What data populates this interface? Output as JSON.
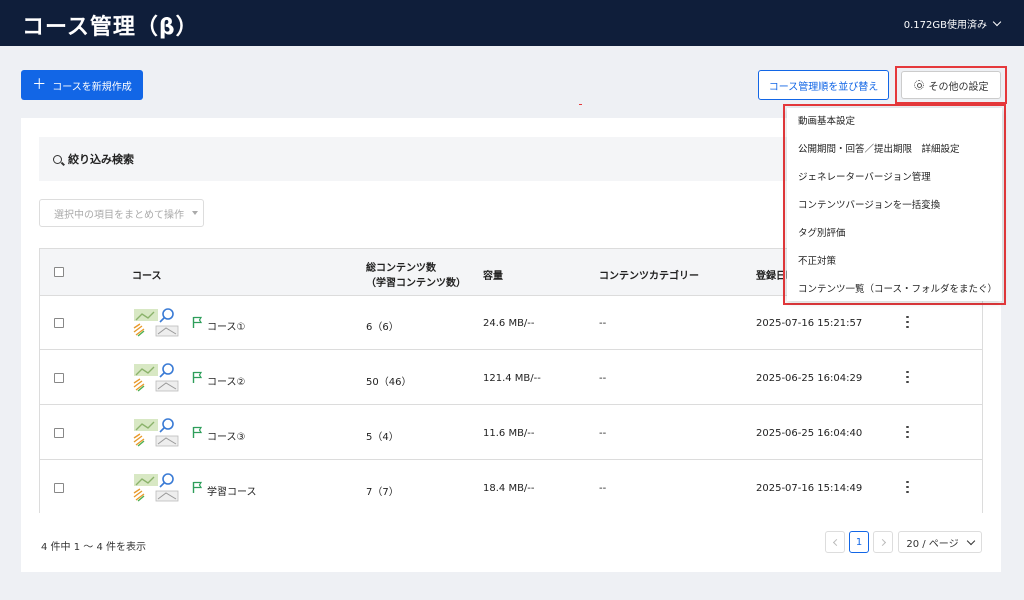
{
  "header": {
    "title": "コース管理（β）",
    "usage": "0.172GB使用済み"
  },
  "toolbar": {
    "new_course": "コースを新規作成",
    "sort": "コース管理順を並び替え",
    "settings": "その他の設定"
  },
  "settings_menu": [
    "動画基本設定",
    "公開期間・回答／提出期限　詳細設定",
    "ジェネレーターバージョン管理",
    "コンテンツバージョンを一括変換",
    "タグ別評価",
    "不正対策",
    "コンテンツ一覧（コース・フォルダをまたぐ）"
  ],
  "search": {
    "label": "絞り込み検索"
  },
  "bulk_action": {
    "label": "選択中の項目をまとめて操作"
  },
  "table": {
    "headers": {
      "course": "コース",
      "contents_line1": "総コンテンツ数",
      "contents_line2": "（学習コンテンツ数）",
      "size": "容量",
      "category": "コンテンツカテゴリー",
      "date": "登録日時"
    },
    "rows": [
      {
        "name": "コース①",
        "contents": "6（6）",
        "size": "24.6 MB/--",
        "category": "--",
        "date": "2025-07-16 15:21:57"
      },
      {
        "name": "コース②",
        "contents": "50（46）",
        "size": "121.4 MB/--",
        "category": "--",
        "date": "2025-06-25 16:04:29"
      },
      {
        "name": "コース③",
        "contents": "5（4）",
        "size": "11.6 MB/--",
        "category": "--",
        "date": "2025-06-25 16:04:40"
      },
      {
        "name": "学習コース",
        "contents": "7（7）",
        "size": "18.4 MB/--",
        "category": "--",
        "date": "2025-07-16 15:14:49"
      }
    ]
  },
  "pagination": {
    "summary": "4 件中 1 ～ 4 件を表示",
    "current_page": "1",
    "per_page": "20 / ページ"
  },
  "colors": {
    "header_bg": "#0f1e3a",
    "primary": "#1266e6",
    "highlight": "#e5383b"
  }
}
